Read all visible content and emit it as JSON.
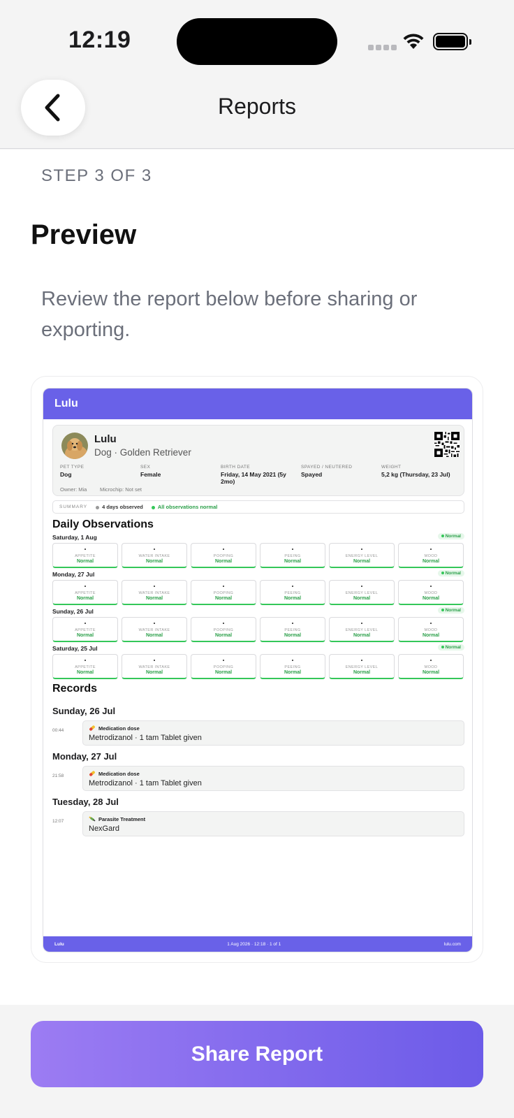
{
  "status": {
    "time": "12:19"
  },
  "nav": {
    "title": "Reports"
  },
  "content": {
    "step": "STEP 3 OF 3",
    "title": "Preview",
    "description": "Review the report below before sharing or exporting."
  },
  "report": {
    "header": "Lulu",
    "pet": {
      "name": "Lulu",
      "breed": "Dog · Golden Retriever",
      "fields": [
        {
          "label": "PET TYPE",
          "value": "Dog"
        },
        {
          "label": "SEX",
          "value": "Female"
        },
        {
          "label": "BIRTH DATE",
          "value": "Friday, 14 May 2021 (5y 2mo)"
        },
        {
          "label": "SPAYED / NEUTERED",
          "value": "Spayed"
        },
        {
          "label": "WEIGHT",
          "value": "5,2 kg (Thursday, 23 Jul)"
        }
      ],
      "owner": "Owner: Mia",
      "microchip": "Microchip: Not set"
    },
    "summary": {
      "label": "SUMMARY",
      "days": "4 days observed",
      "status": "All observations normal"
    },
    "observations_title": "Daily Observations",
    "observation_categories": [
      "APPETITE",
      "WATER INTAKE",
      "POOPING",
      "PEEING",
      "ENERGY LEVEL",
      "MOOD"
    ],
    "observation_value": "Normal",
    "observation_days": [
      {
        "date": "Saturday, 1 Aug",
        "badge": "Normal"
      },
      {
        "date": "Monday, 27 Jul",
        "badge": "Normal"
      },
      {
        "date": "Sunday, 26 Jul",
        "badge": "Normal"
      },
      {
        "date": "Saturday, 25 Jul",
        "badge": "Normal"
      }
    ],
    "records_title": "Records",
    "records": [
      {
        "date": "Sunday, 26 Jul",
        "time": "00:44",
        "type": "Medication dose",
        "desc": "Metrodizanol · 1 tam Tablet given",
        "icon": "pill-icon"
      },
      {
        "date": "Monday, 27 Jul",
        "time": "21:58",
        "type": "Medication dose",
        "desc": "Metrodizanol · 1 tam Tablet given",
        "icon": "pill-icon"
      },
      {
        "date": "Tuesday, 28 Jul",
        "time": "12:07",
        "type": "Parasite Treatment",
        "desc": "NexGard",
        "icon": "syringe-icon"
      }
    ],
    "footer": {
      "brand": "Lulu",
      "center": "1 Aug 2026 · 12:18 · 1 of 1",
      "site": "lulu.com"
    }
  },
  "share_button": "Share Report",
  "colors": {
    "accent": "#6961e8",
    "normal": "#34c759",
    "button_start": "#9c7cf3",
    "button_end": "#6c5be8"
  }
}
